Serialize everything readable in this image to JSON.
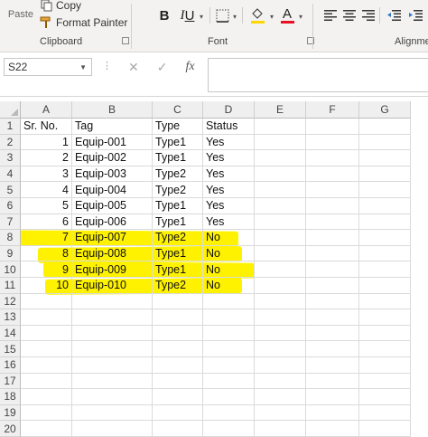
{
  "ribbon": {
    "clipboard": {
      "paste_label": "Paste",
      "copy_label": "Copy",
      "format_painter_label": "Format Painter",
      "group_label": "Clipboard"
    },
    "font": {
      "bold": "B",
      "italic": "I",
      "underline": "U",
      "font_color_glyph": "A",
      "font_color": "#e81123",
      "fill_color": "#ffd700",
      "group_label": "Font"
    },
    "alignment": {
      "group_label": "Alignme"
    }
  },
  "formula_bar": {
    "name_box": "S22",
    "cancel_glyph": "✕",
    "enter_glyph": "✓",
    "fx_glyph": "fx",
    "formula": ""
  },
  "sheet": {
    "columns": [
      "A",
      "B",
      "C",
      "D",
      "E",
      "F",
      "G"
    ],
    "row_numbers": [
      "1",
      "2",
      "3",
      "4",
      "5",
      "6",
      "7",
      "8",
      "9",
      "10",
      "11",
      "12",
      "13",
      "14",
      "15",
      "16",
      "17",
      "18",
      "19",
      "20"
    ],
    "header": [
      "Sr. No.",
      "Tag",
      "Type",
      "Status"
    ],
    "rows": [
      [
        "1",
        "Equip-001",
        "Type1",
        "Yes"
      ],
      [
        "2",
        "Equip-002",
        "Type1",
        "Yes"
      ],
      [
        "3",
        "Equip-003",
        "Type2",
        "Yes"
      ],
      [
        "4",
        "Equip-004",
        "Type2",
        "Yes"
      ],
      [
        "5",
        "Equip-005",
        "Type1",
        "Yes"
      ],
      [
        "6",
        "Equip-006",
        "Type1",
        "Yes"
      ],
      [
        "7",
        "Equip-007",
        "Type2",
        "No"
      ],
      [
        "8",
        "Equip-008",
        "Type1",
        "No"
      ],
      [
        "9",
        "Equip-009",
        "Type1",
        "No"
      ],
      [
        "10",
        "Equip-010",
        "Type2",
        "No"
      ]
    ],
    "highlight_color": "#fff200"
  }
}
